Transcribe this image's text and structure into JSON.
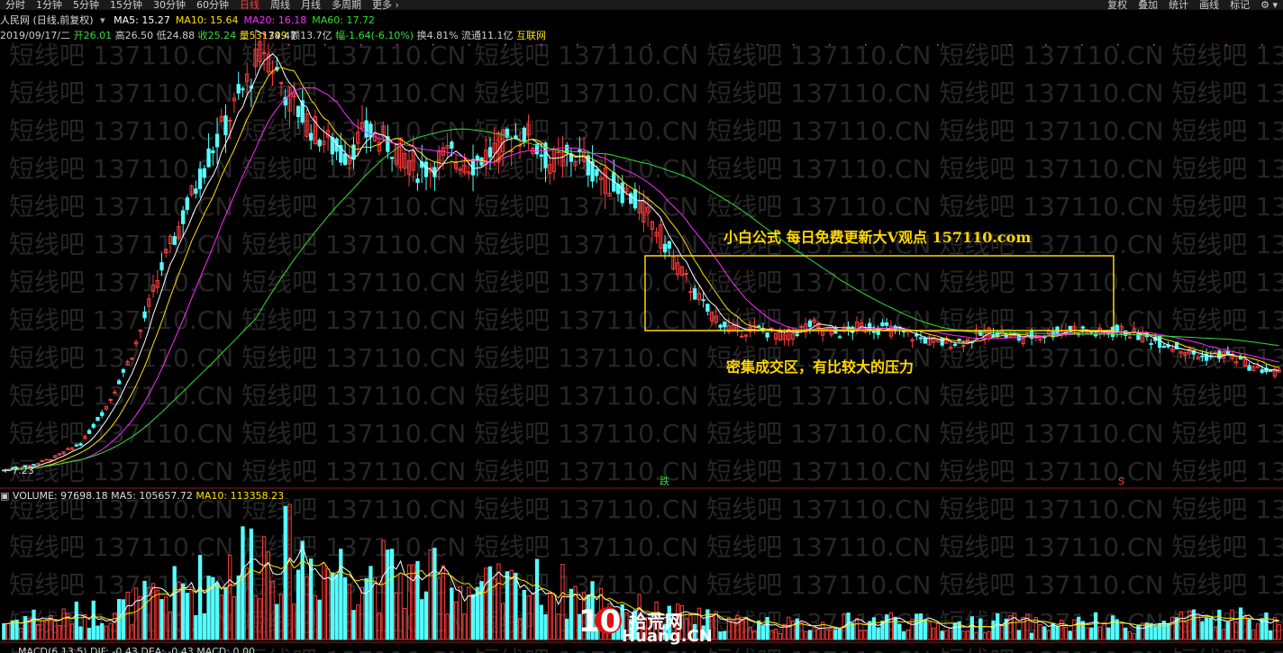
{
  "toolbar": {
    "left": [
      "分时",
      "1分钟",
      "5分钟",
      "15分钟",
      "30分钟",
      "60分钟",
      "日线",
      "周线",
      "月线",
      "多周期",
      "更多 ›"
    ],
    "active": "日线",
    "right": [
      "复权",
      "叠加",
      "统计",
      "画线",
      "标记",
      "⚙ ▾"
    ]
  },
  "stock_label": "人民网 (日线,前复权)",
  "ma": [
    {
      "label": "MA5: 15.27",
      "color": "#ffffff"
    },
    {
      "label": "MA10: 15.64",
      "color": "#ffe200"
    },
    {
      "label": "MA20: 16.18",
      "color": "#ff2bff"
    },
    {
      "label": "MA60: 17.72",
      "color": "#33dd33"
    }
  ],
  "bar_info": {
    "date": "2019/09/17/二",
    "open": "开26.01",
    "high": "高26.50",
    "low": "低24.88",
    "close": "收25.24",
    "volume": "量531799",
    "amount": "额13.7亿",
    "change": "幅-1.64(-6.10%)",
    "turnover": "换4.81%",
    "float": "流通11.1亿",
    "sector": "互联网"
  },
  "price_high_label": "34.47",
  "price_low_label": "7.23",
  "marker_die": "跌",
  "marker_s": "S",
  "volume_info": {
    "volume": "VOLUME: 97698.18",
    "ma5": "MA5: 105657.72",
    "ma10": "MA10: 113358.23"
  },
  "macd_info": "MACD(6,13,5)  DIF: -0.43  DEA: -0.43  MACD: 0.00",
  "annotation_top": "小白公式 每日免费更新大V观点 157110.com",
  "annotation_bottom": "密集成交区，有比较大的压力",
  "watermark": "短线吧 137110.CN 短线吧 137110.CN 短线吧 137110.CN 短线吧 137110.CN 短线吧 137110.CN 短线吧 137110.CN",
  "logo": {
    "num": "10",
    "cn": "拾荒网",
    "domain": "Huang.CN"
  },
  "colors": {
    "up": "#ff3c3c",
    "down": "#54ffff",
    "ma5": "#ffffff",
    "ma10": "#ffe200",
    "ma20": "#ff2bff",
    "ma60": "#33dd33",
    "box": "#ffd800"
  },
  "chart_data": {
    "type": "candlestick",
    "price_ylim": [
      7.23,
      34.47
    ],
    "close_anchors": [
      7.23,
      7.5,
      8.1,
      9,
      11.5,
      15,
      20,
      24,
      28,
      31,
      34.47,
      31,
      29,
      27.5,
      29,
      28,
      26.5,
      27.5,
      27,
      28,
      29,
      27,
      27.5,
      26,
      25,
      23,
      20,
      17.5,
      16.2,
      16.3,
      15.8,
      16.6,
      16,
      16.5,
      16.3,
      15.8,
      15.4,
      15.6,
      16.2,
      15.7,
      16,
      16.4,
      16,
      16.2,
      15.7,
      15.2,
      14.5,
      14.7,
      13.8,
      13.5
    ],
    "volume_anchors": [
      6,
      8,
      7,
      9,
      10,
      12,
      15,
      18,
      22,
      28,
      32,
      30,
      27,
      25,
      24,
      22,
      21,
      20,
      18,
      17,
      19,
      18,
      16,
      14,
      11,
      9,
      8,
      7,
      6,
      6,
      5,
      5,
      6,
      6,
      7,
      6,
      5,
      5,
      6,
      6,
      5,
      5,
      6,
      5,
      5,
      6,
      7,
      8,
      7,
      6
    ]
  }
}
